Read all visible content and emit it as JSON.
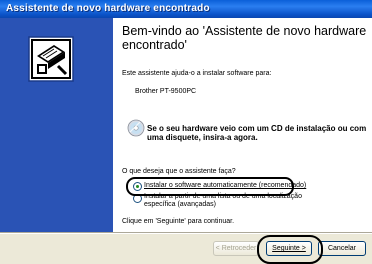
{
  "window": {
    "title": "Assistente de novo hardware encontrado"
  },
  "content": {
    "heading": "Bem-vindo ao 'Assistente de novo hardware encontrado'",
    "intro": "Este assistente ajuda-o a instalar software para:",
    "device": "Brother PT-9500PC",
    "cd_prompt": "Se o seu hardware veio com um CD de instalação ou com uma disquete, insira-a agora.",
    "question": "O que deseja que o assistente faça?",
    "options": [
      {
        "label": "Instalar o software automaticamente (recomendado)",
        "selected": true
      },
      {
        "label": "Instalar a partir de uma lista ou de uma localização específica (avançadas)",
        "selected": false
      }
    ],
    "continue_text": "Clique em 'Seguinte' para continuar."
  },
  "buttons": {
    "back": "< Retroceder",
    "next": "Seguinte >",
    "cancel": "Cancelar"
  },
  "colors": {
    "sidebar": "#2a53b5",
    "titlebar": "#0a5fd8",
    "footer": "#ece9d8"
  }
}
